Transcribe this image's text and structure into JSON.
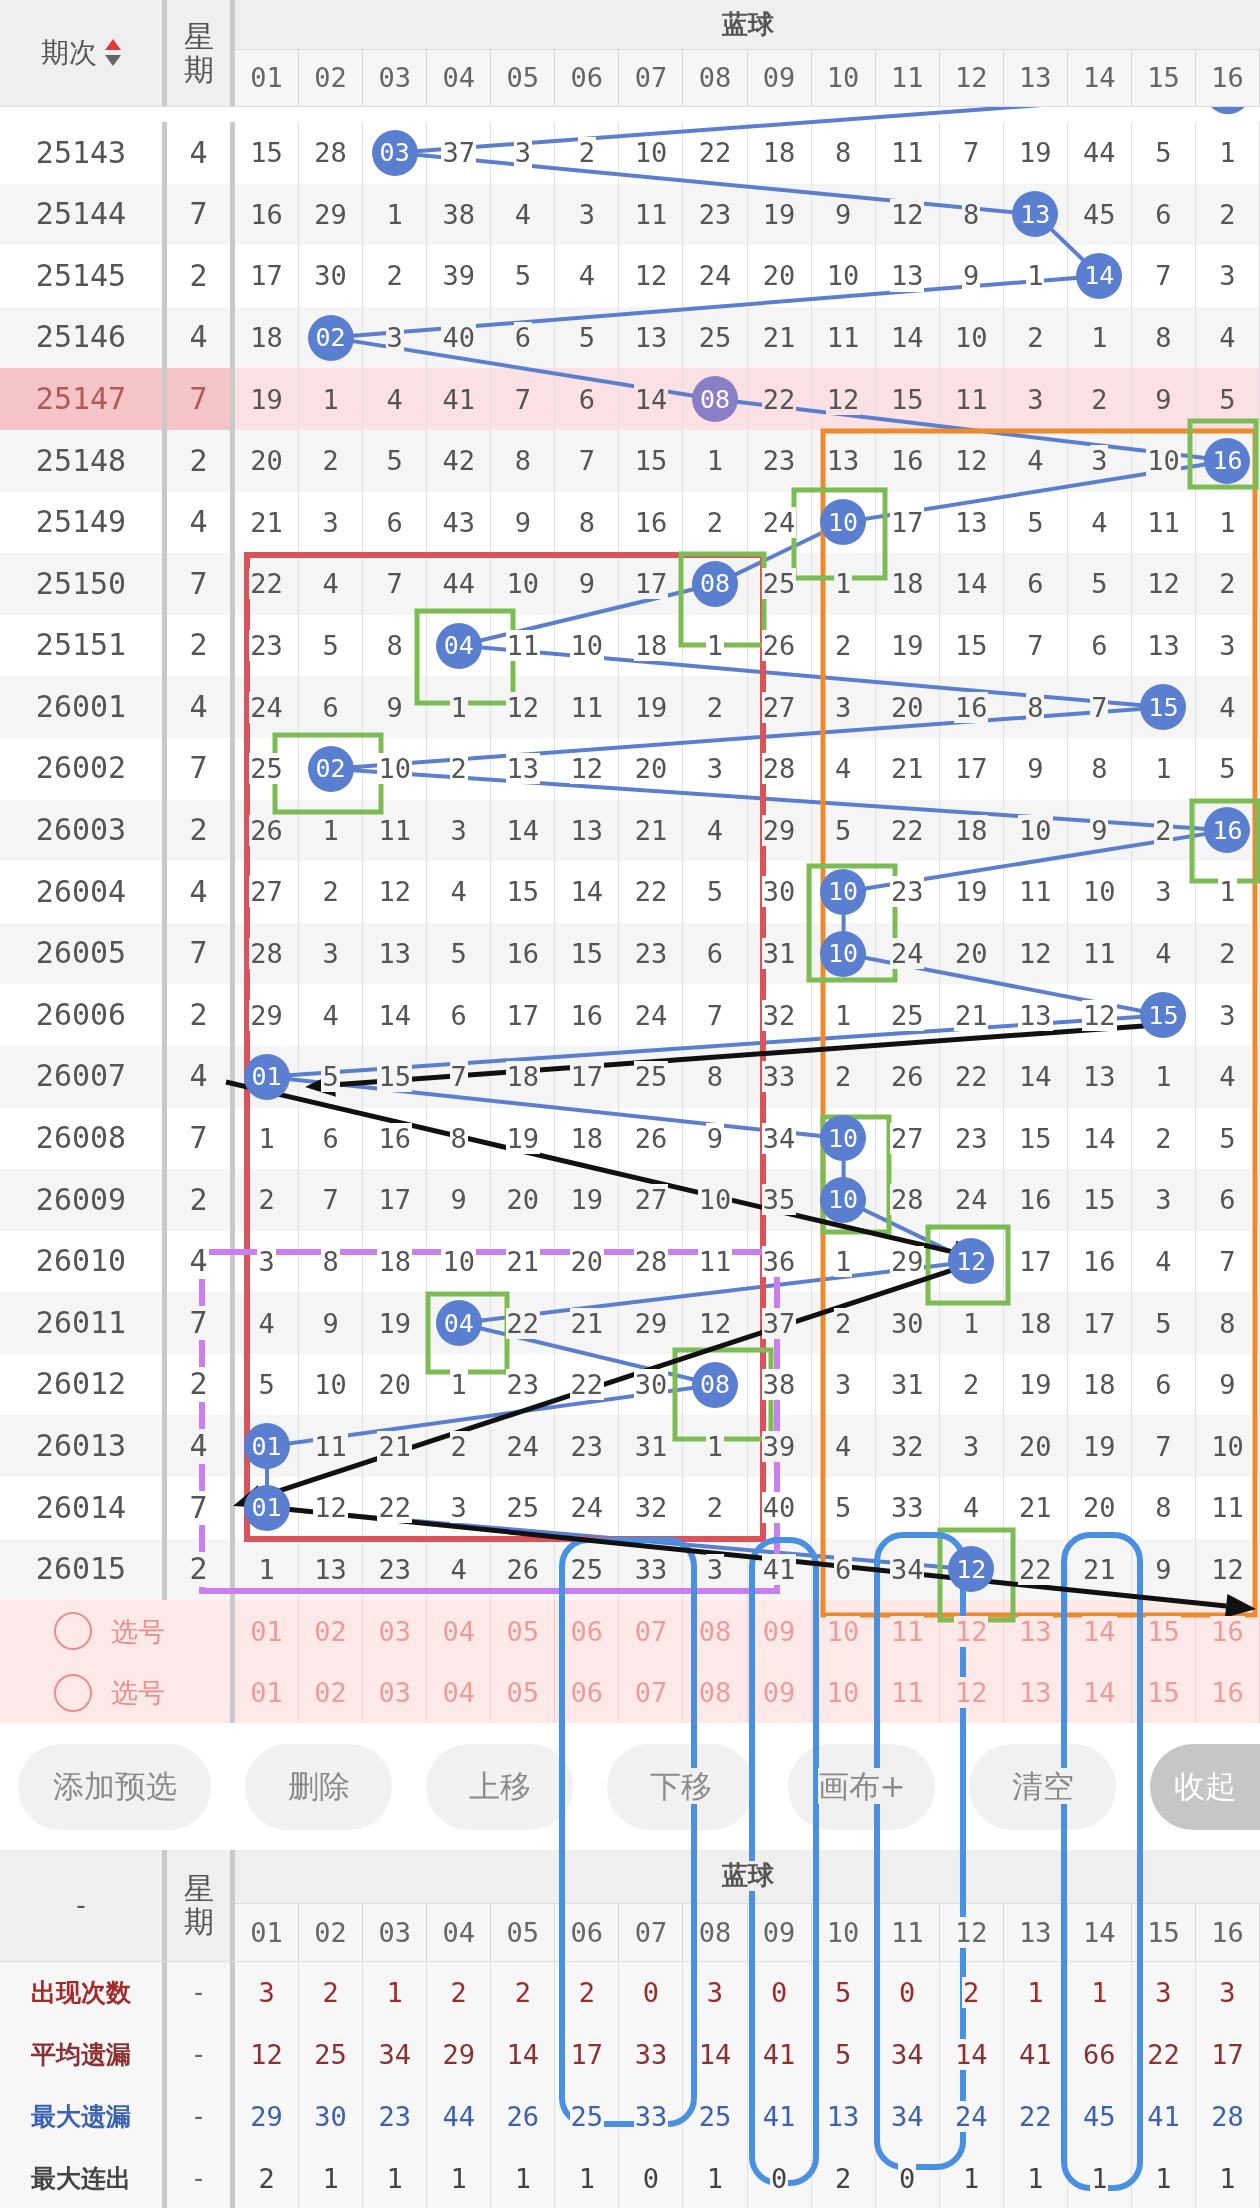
{
  "header": {
    "issue_label": "期次",
    "weekday_label": "星期",
    "group_label": "蓝球",
    "columns": [
      "01",
      "02",
      "03",
      "04",
      "05",
      "06",
      "07",
      "08",
      "09",
      "10",
      "11",
      "12",
      "13",
      "14",
      "15",
      "16"
    ]
  },
  "rows": [
    {
      "issue": "25143",
      "weekday": "4",
      "highlighted": false,
      "cells": [
        "15",
        "28",
        {
          "ball": "03"
        },
        "37",
        "3",
        "2",
        "10",
        "22",
        "18",
        "8",
        "11",
        "7",
        "19",
        "44",
        "5",
        "1"
      ]
    },
    {
      "issue": "25144",
      "weekday": "7",
      "highlighted": false,
      "cells": [
        "16",
        "29",
        "1",
        "38",
        "4",
        "3",
        "11",
        "23",
        "19",
        "9",
        "12",
        "8",
        {
          "ball": "13"
        },
        "45",
        "6",
        "2"
      ]
    },
    {
      "issue": "25145",
      "weekday": "2",
      "highlighted": false,
      "cells": [
        "17",
        "30",
        "2",
        "39",
        "5",
        "4",
        "12",
        "24",
        "20",
        "10",
        "13",
        "9",
        "1",
        {
          "ball": "14"
        },
        "7",
        "3"
      ]
    },
    {
      "issue": "25146",
      "weekday": "4",
      "highlighted": false,
      "cells": [
        "18",
        {
          "ball": "02"
        },
        "3",
        "40",
        "6",
        "5",
        "13",
        "25",
        "21",
        "11",
        "14",
        "10",
        "2",
        "1",
        "8",
        "4"
      ]
    },
    {
      "issue": "25147",
      "weekday": "7",
      "highlighted": true,
      "cells": [
        "19",
        "1",
        "4",
        "41",
        "7",
        "6",
        "14",
        {
          "ball": "08"
        },
        "22",
        "12",
        "15",
        "11",
        "3",
        "2",
        "9",
        "5"
      ]
    },
    {
      "issue": "25148",
      "weekday": "2",
      "highlighted": false,
      "cells": [
        "20",
        "2",
        "5",
        "42",
        "8",
        "7",
        "15",
        "1",
        "23",
        "13",
        "16",
        "12",
        "4",
        "3",
        "10",
        {
          "ball": "16"
        }
      ]
    },
    {
      "issue": "25149",
      "weekday": "4",
      "highlighted": false,
      "cells": [
        "21",
        "3",
        "6",
        "43",
        "9",
        "8",
        "16",
        "2",
        "24",
        {
          "ball": "10"
        },
        "17",
        "13",
        "5",
        "4",
        "11",
        "1"
      ]
    },
    {
      "issue": "25150",
      "weekday": "7",
      "highlighted": false,
      "cells": [
        "22",
        "4",
        "7",
        "44",
        "10",
        "9",
        "17",
        {
          "ball": "08"
        },
        "25",
        "1",
        "18",
        "14",
        "6",
        "5",
        "12",
        "2"
      ]
    },
    {
      "issue": "25151",
      "weekday": "2",
      "highlighted": false,
      "cells": [
        "23",
        "5",
        "8",
        {
          "ball": "04"
        },
        "11",
        "10",
        "18",
        "1",
        "26",
        "2",
        "19",
        "15",
        "7",
        "6",
        "13",
        "3"
      ]
    },
    {
      "issue": "26001",
      "weekday": "4",
      "highlighted": false,
      "cells": [
        "24",
        "6",
        "9",
        "1",
        "12",
        "11",
        "19",
        "2",
        "27",
        "3",
        "20",
        "16",
        "8",
        "7",
        {
          "ball": "15"
        },
        "4"
      ]
    },
    {
      "issue": "26002",
      "weekday": "7",
      "highlighted": false,
      "cells": [
        "25",
        {
          "ball": "02"
        },
        "10",
        "2",
        "13",
        "12",
        "20",
        "3",
        "28",
        "4",
        "21",
        "17",
        "9",
        "8",
        "1",
        "5"
      ]
    },
    {
      "issue": "26003",
      "weekday": "2",
      "highlighted": false,
      "cells": [
        "26",
        "1",
        "11",
        "3",
        "14",
        "13",
        "21",
        "4",
        "29",
        "5",
        "22",
        "18",
        "10",
        "9",
        "2",
        {
          "ball": "16"
        }
      ]
    },
    {
      "issue": "26004",
      "weekday": "4",
      "highlighted": false,
      "cells": [
        "27",
        "2",
        "12",
        "4",
        "15",
        "14",
        "22",
        "5",
        "30",
        {
          "ball": "10"
        },
        "23",
        "19",
        "11",
        "10",
        "3",
        "1"
      ]
    },
    {
      "issue": "26005",
      "weekday": "7",
      "highlighted": false,
      "cells": [
        "28",
        "3",
        "13",
        "5",
        "16",
        "15",
        "23",
        "6",
        "31",
        {
          "ball": "10"
        },
        "24",
        "20",
        "12",
        "11",
        "4",
        "2"
      ]
    },
    {
      "issue": "26006",
      "weekday": "2",
      "highlighted": false,
      "cells": [
        "29",
        "4",
        "14",
        "6",
        "17",
        "16",
        "24",
        "7",
        "32",
        "1",
        "25",
        "21",
        "13",
        "12",
        {
          "ball": "15"
        },
        "3"
      ]
    },
    {
      "issue": "26007",
      "weekday": "4",
      "highlighted": false,
      "cells": [
        {
          "ball": "01"
        },
        "5",
        "15",
        "7",
        "18",
        "17",
        "25",
        "8",
        "33",
        "2",
        "26",
        "22",
        "14",
        "13",
        "1",
        "4"
      ]
    },
    {
      "issue": "26008",
      "weekday": "7",
      "highlighted": false,
      "cells": [
        "1",
        "6",
        "16",
        "8",
        "19",
        "18",
        "26",
        "9",
        "34",
        {
          "ball": "10"
        },
        "27",
        "23",
        "15",
        "14",
        "2",
        "5"
      ]
    },
    {
      "issue": "26009",
      "weekday": "2",
      "highlighted": false,
      "cells": [
        "2",
        "7",
        "17",
        "9",
        "20",
        "19",
        "27",
        "10",
        "35",
        {
          "ball": "10"
        },
        "28",
        "24",
        "16",
        "15",
        "3",
        "6"
      ]
    },
    {
      "issue": "26010",
      "weekday": "4",
      "highlighted": false,
      "cells": [
        "3",
        "8",
        "18",
        "10",
        "21",
        "20",
        "28",
        "11",
        "36",
        "1",
        "29",
        {
          "ball": "12"
        },
        "17",
        "16",
        "4",
        "7"
      ]
    },
    {
      "issue": "26011",
      "weekday": "7",
      "highlighted": false,
      "cells": [
        "4",
        "9",
        "19",
        {
          "ball": "04"
        },
        "22",
        "21",
        "29",
        "12",
        "37",
        "2",
        "30",
        "1",
        "18",
        "17",
        "5",
        "8"
      ]
    },
    {
      "issue": "26012",
      "weekday": "2",
      "highlighted": false,
      "cells": [
        "5",
        "10",
        "20",
        "1",
        "23",
        "22",
        "30",
        {
          "ball": "08"
        },
        "38",
        "3",
        "31",
        "2",
        "19",
        "18",
        "6",
        "9"
      ]
    },
    {
      "issue": "26013",
      "weekday": "4",
      "highlighted": false,
      "cells": [
        {
          "ball": "01"
        },
        "11",
        "21",
        "2",
        "24",
        "23",
        "31",
        "1",
        "39",
        "4",
        "32",
        "3",
        "20",
        "19",
        "7",
        "10"
      ]
    },
    {
      "issue": "26014",
      "weekday": "7",
      "highlighted": false,
      "cells": [
        {
          "ball": "01"
        },
        "12",
        "22",
        "3",
        "25",
        "24",
        "32",
        "2",
        "40",
        "5",
        "33",
        "4",
        "21",
        "20",
        "8",
        "11"
      ]
    },
    {
      "issue": "26015",
      "weekday": "2",
      "highlighted": false,
      "cells": [
        "1",
        "13",
        "23",
        "4",
        "26",
        "25",
        "33",
        "3",
        "41",
        "6",
        "34",
        {
          "ball": "12"
        },
        "22",
        "21",
        "9",
        "12"
      ]
    }
  ],
  "pick_rows": [
    {
      "label": "选号",
      "checked": false,
      "numbers": [
        "01",
        "02",
        "03",
        "04",
        "05",
        "06",
        "07",
        "08",
        "09",
        "10",
        "11",
        "12",
        "13",
        "14",
        "15",
        "16"
      ]
    },
    {
      "label": "选号",
      "checked": false,
      "numbers": [
        "01",
        "02",
        "03",
        "04",
        "05",
        "06",
        "07",
        "08",
        "09",
        "10",
        "11",
        "12",
        "13",
        "14",
        "15",
        "16"
      ]
    }
  ],
  "buttons": [
    {
      "label": "添加预选",
      "kind": "plain"
    },
    {
      "label": "删除",
      "kind": "plain"
    },
    {
      "label": "上移",
      "kind": "plain"
    },
    {
      "label": "下移",
      "kind": "plain"
    },
    {
      "label": "画布+",
      "kind": "plain"
    },
    {
      "label": "清空",
      "kind": "plain"
    },
    {
      "label": "收起",
      "kind": "collapse"
    }
  ],
  "stats": {
    "corner": "-",
    "weekday_label": "星期",
    "group_label": "蓝球",
    "columns": [
      "01",
      "02",
      "03",
      "04",
      "05",
      "06",
      "07",
      "08",
      "09",
      "10",
      "11",
      "12",
      "13",
      "14",
      "15",
      "16"
    ],
    "rows": [
      {
        "label": "出现次数",
        "weekday": "-",
        "color": "#a52828",
        "values": [
          "3",
          "2",
          "1",
          "2",
          "2",
          "2",
          "0",
          "3",
          "0",
          "5",
          "0",
          "2",
          "1",
          "1",
          "3",
          "3"
        ]
      },
      {
        "label": "平均遗漏",
        "weekday": "-",
        "color": "#8e3030",
        "values": [
          "12",
          "25",
          "34",
          "29",
          "14",
          "17",
          "33",
          "14",
          "41",
          "5",
          "34",
          "14",
          "41",
          "66",
          "22",
          "17"
        ]
      },
      {
        "label": "最大遗漏",
        "weekday": "-",
        "color": "#3a62b4",
        "values": [
          "29",
          "30",
          "23",
          "44",
          "26",
          "25",
          "33",
          "25",
          "41",
          "13",
          "34",
          "24",
          "22",
          "45",
          "41",
          "28"
        ]
      },
      {
        "label": "最大连出",
        "weekday": "-",
        "color": "#444444",
        "values": [
          "2",
          "1",
          "1",
          "1",
          "1",
          "1",
          "0",
          "1",
          "0",
          "2",
          "0",
          "1",
          "1",
          "1",
          "1",
          "1"
        ]
      }
    ]
  }
}
